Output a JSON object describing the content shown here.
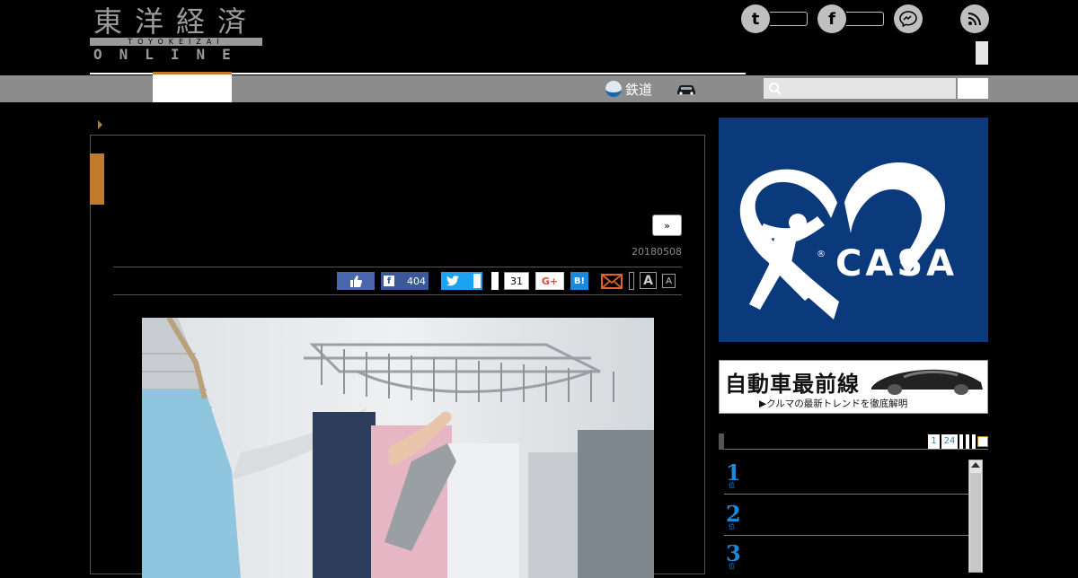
{
  "header": {
    "logo": {
      "kanji": "東洋経済",
      "romaji": "TOYOKEIZAI",
      "online": "ONLINE"
    },
    "social": [
      {
        "icon": "twitter-icon",
        "glyph": "t"
      },
      {
        "icon": "facebook-icon",
        "glyph": "f"
      },
      {
        "icon": "messenger-icon",
        "glyph": "~"
      },
      {
        "icon": "rss-icon",
        "glyph": ")"
      }
    ]
  },
  "nav": {
    "items": [
      {
        "label": "鉄道",
        "icon": "train-icon"
      },
      {
        "label": "",
        "icon": "car-icon"
      }
    ],
    "search": {
      "placeholder": ""
    }
  },
  "article": {
    "next_label": "»",
    "date": "20180508",
    "share": {
      "facebook_count": "404",
      "comment_count": "31",
      "googleplus_label": "G+",
      "hatena_label": "B!",
      "font_large": "A",
      "font_small": "A"
    }
  },
  "sidebar": {
    "ad_casa_text": "CASA",
    "car_banner": {
      "title": "自動車最前線",
      "subtitle": "▶クルマの最新トレンドを徹底解明"
    },
    "ranking": {
      "tabs": [
        "1",
        "24"
      ],
      "items": [
        {
          "rank": "1",
          "unit": "位"
        },
        {
          "rank": "2",
          "unit": "位"
        },
        {
          "rank": "3",
          "unit": "位"
        }
      ]
    }
  },
  "colors": {
    "accent": "#c07b2a",
    "nav_bg": "#8c8c8c",
    "facebook": "#3b5998",
    "twitter": "#1da1f2",
    "casa_bg": "#0b3a7c",
    "rank_blue": "#1e88d8"
  }
}
